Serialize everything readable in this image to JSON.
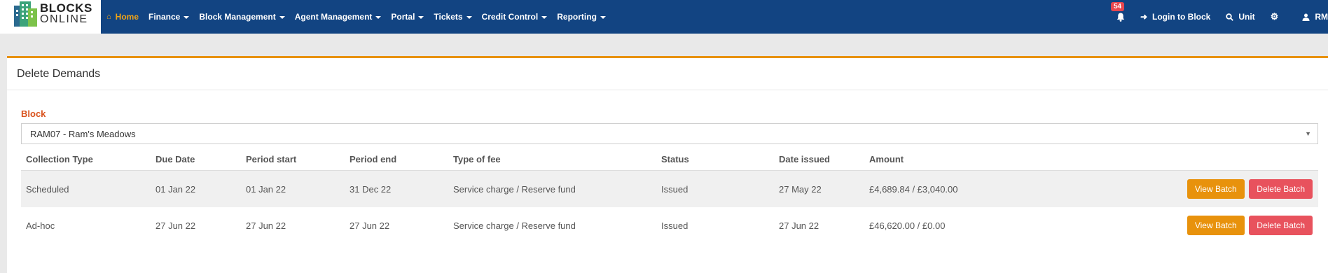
{
  "brand": {
    "line1": "BLOCKS",
    "line2": "ONLINE"
  },
  "nav": {
    "items": [
      {
        "label": "Home",
        "icon": "home-icon"
      },
      {
        "label": "Finance"
      },
      {
        "label": "Block Management"
      },
      {
        "label": "Agent Management"
      },
      {
        "label": "Portal"
      },
      {
        "label": "Tickets"
      },
      {
        "label": "Credit Control"
      },
      {
        "label": "Reporting"
      }
    ],
    "notification_count": "54",
    "login_to_block": "Login to Block",
    "unit": "Unit",
    "user": "RM"
  },
  "panel": {
    "title": "Delete Demands",
    "block_label": "Block",
    "block_selected": "RAM07 - Ram's Meadows"
  },
  "table": {
    "headers": [
      "Collection Type",
      "Due Date",
      "Period start",
      "Period end",
      "Type of fee",
      "Status",
      "Date issued",
      "Amount"
    ],
    "rows": [
      {
        "collection_type": "Scheduled",
        "due_date": "01 Jan 22",
        "period_start": "01 Jan 22",
        "period_end": "31 Dec 22",
        "type_of_fee": "Service charge / Reserve fund",
        "status": "Issued",
        "date_issued": "27 May 22",
        "amount": "£4,689.84 / £3,040.00"
      },
      {
        "collection_type": "Ad-hoc",
        "due_date": "27 Jun 22",
        "period_start": "27 Jun 22",
        "period_end": "27 Jun 22",
        "type_of_fee": "Service charge / Reserve fund",
        "status": "Issued",
        "date_issued": "27 Jun 22",
        "amount": "£46,620.00 / £0.00"
      }
    ],
    "view_label": "View Batch",
    "delete_label": "Delete Batch"
  },
  "colors": {
    "navbar": "#124482",
    "accent": "#e8920c",
    "danger": "#e8525d"
  }
}
